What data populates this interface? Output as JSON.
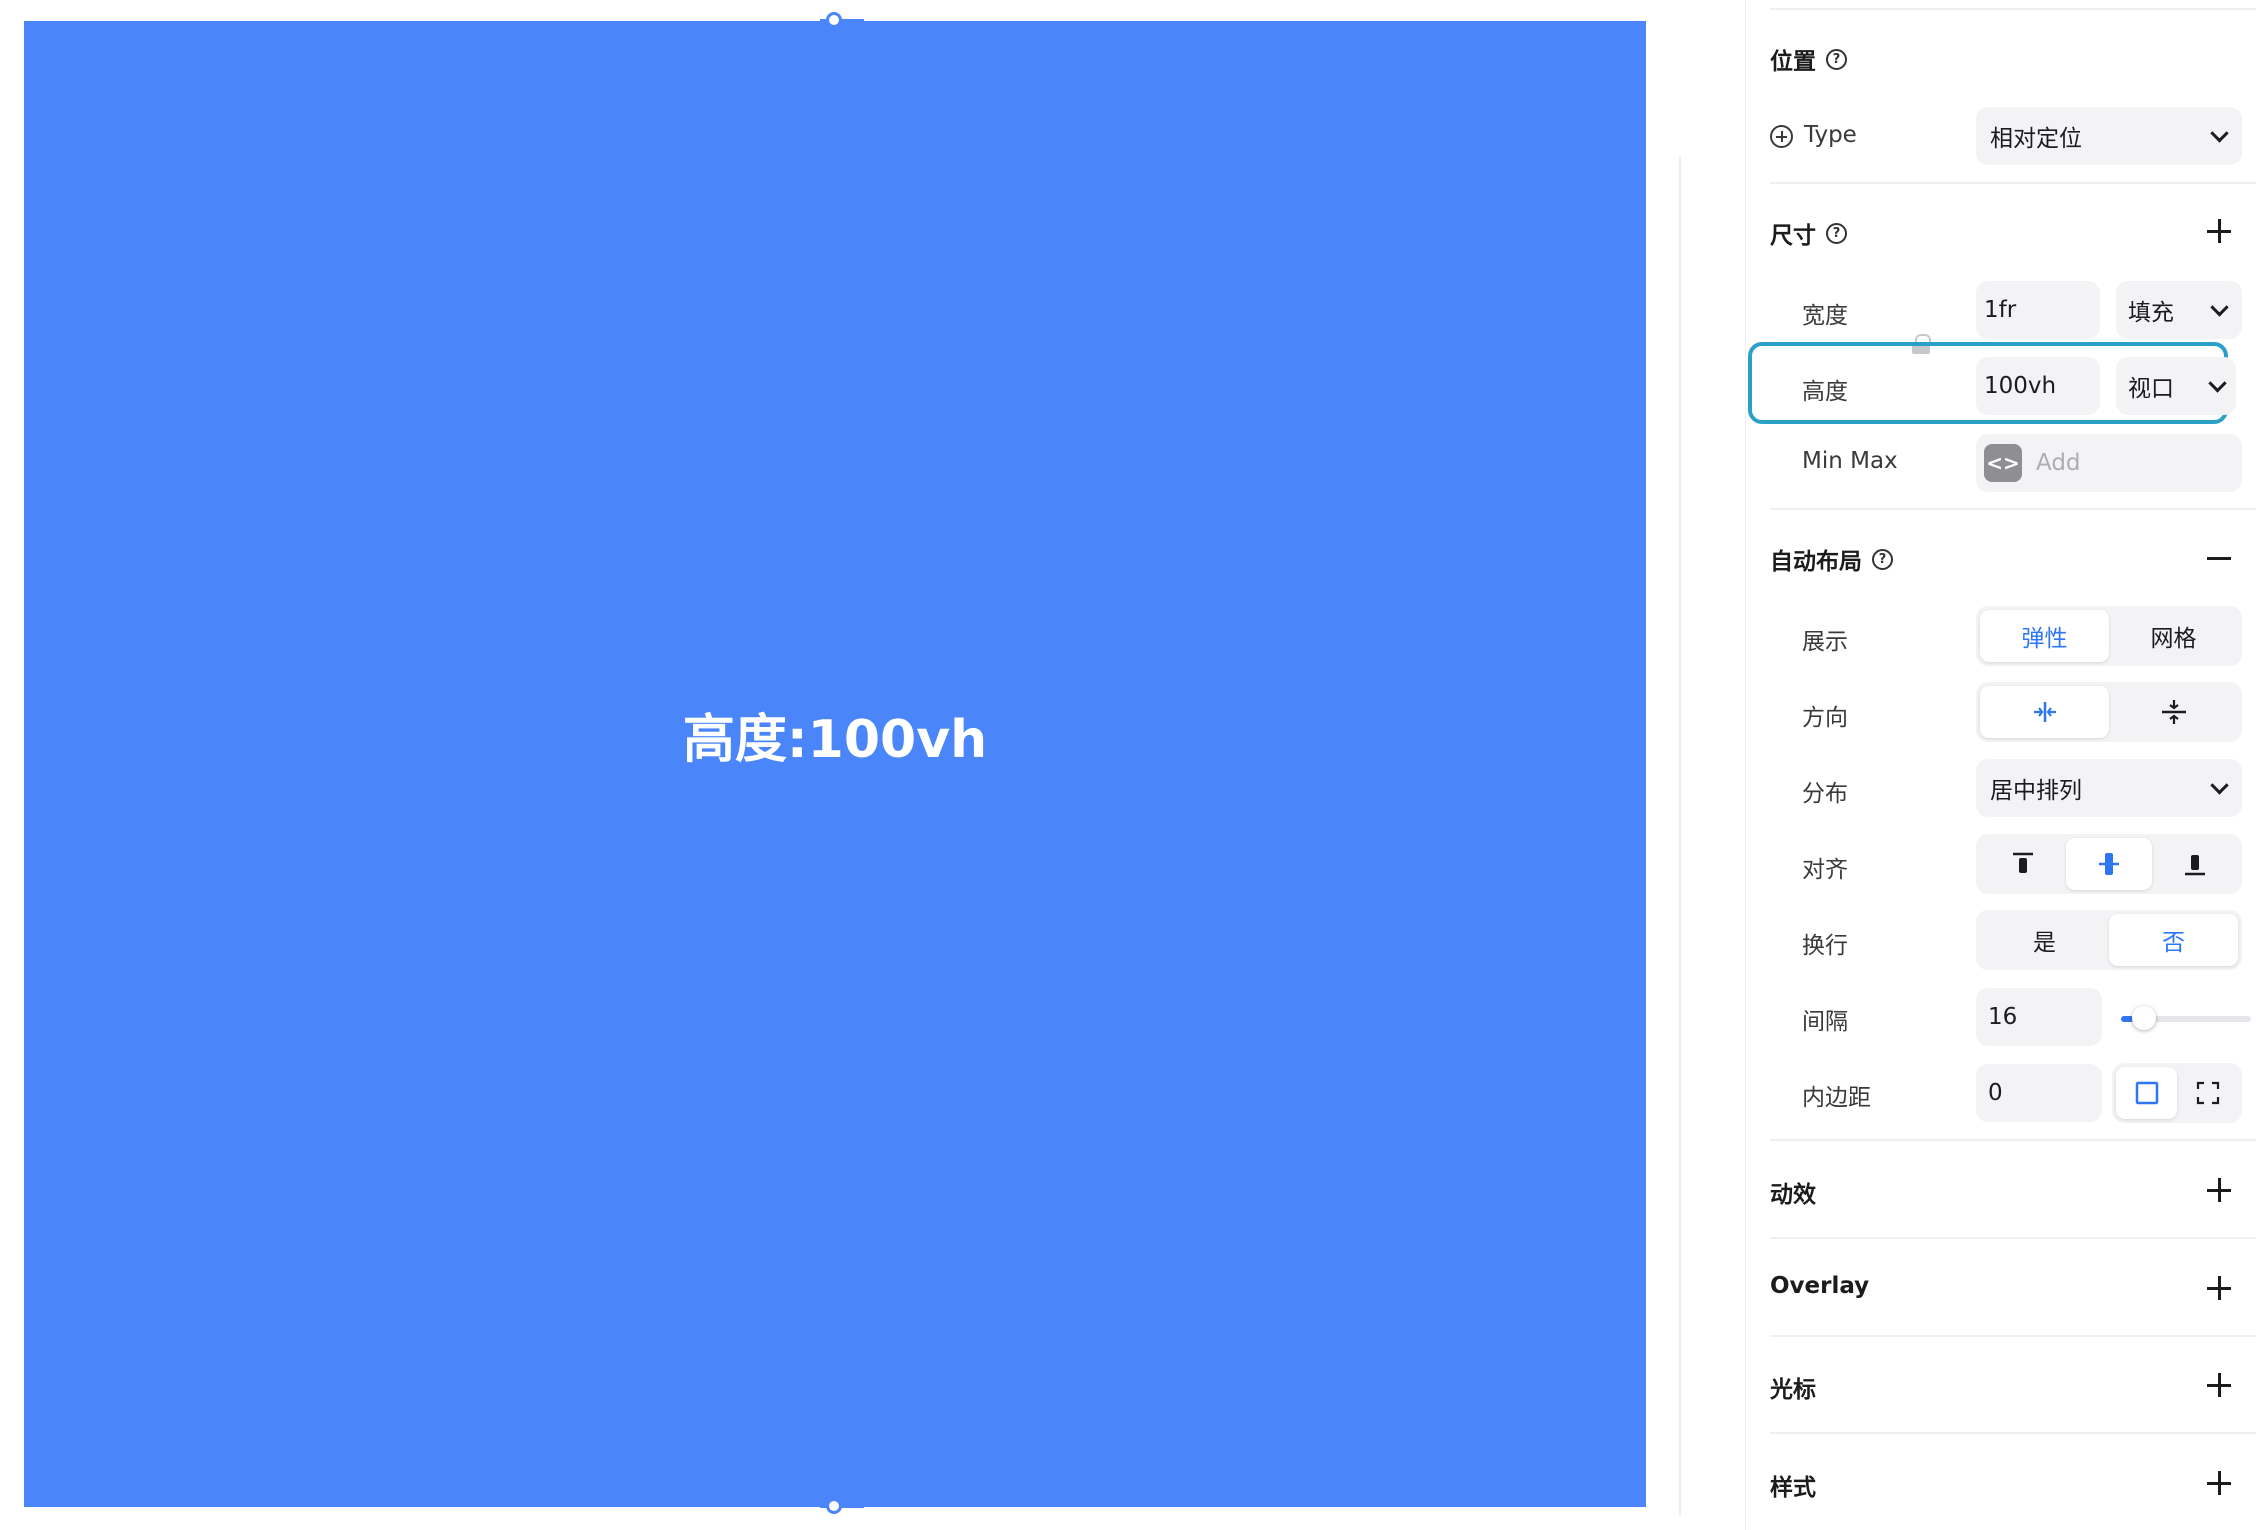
{
  "canvas": {
    "frame_text": "高度:100vh",
    "frame_color": "#4a86f9"
  },
  "panel": {
    "position": {
      "title": "位置",
      "type_label": "Type",
      "type_value": "相对定位"
    },
    "size": {
      "title": "尺寸",
      "width_label": "宽度",
      "width_value": "1fr",
      "width_mode": "填充",
      "height_label": "高度",
      "height_value": "100vh",
      "height_mode": "视口",
      "minmax_label": "Min Max",
      "minmax_placeholder": "Add"
    },
    "auto_layout": {
      "title": "自动布局",
      "display_label": "展示",
      "display_options": [
        "弹性",
        "网格"
      ],
      "direction_label": "方向",
      "distribute_label": "分布",
      "distribute_value": "居中排列",
      "align_label": "对齐",
      "wrap_label": "换行",
      "wrap_options": [
        "是",
        "否"
      ],
      "gap_label": "间隔",
      "gap_value": "16",
      "gap_slider_fraction": 0.1,
      "padding_label": "内边距",
      "padding_value": "0"
    },
    "sections": {
      "animation": "动效",
      "overlay": "Overlay",
      "cursor": "光标",
      "style": "样式"
    },
    "accent_color": "#2f76f4",
    "highlight_color": "#2aa0c9"
  }
}
